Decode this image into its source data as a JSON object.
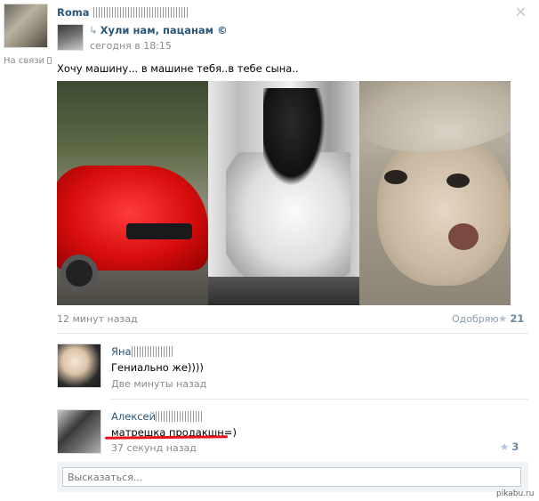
{
  "post": {
    "author_name": "Roma",
    "status_text": "На связи",
    "source_name": "Хули нам, пацанам ©",
    "source_time": "сегодня в 18:15",
    "text": "Хочу машину... в машине тебя..в тебе сына..",
    "age": "12 минут назад",
    "like_label": "Одобряю",
    "like_count": "21"
  },
  "comments": [
    {
      "name": "Яна",
      "text": "Гениально же))))",
      "time": "Две минуты назад"
    },
    {
      "name": "Алексей",
      "text": "матрешка продакшн=)",
      "time": "37 секунд назад",
      "likes": "3"
    }
  ],
  "reply": {
    "placeholder": "Высказаться..."
  },
  "watermark": "pikabu.ru",
  "colors": {
    "link": "#2b587a",
    "muted": "#8a8a8a",
    "highlight": "#e8121a"
  }
}
